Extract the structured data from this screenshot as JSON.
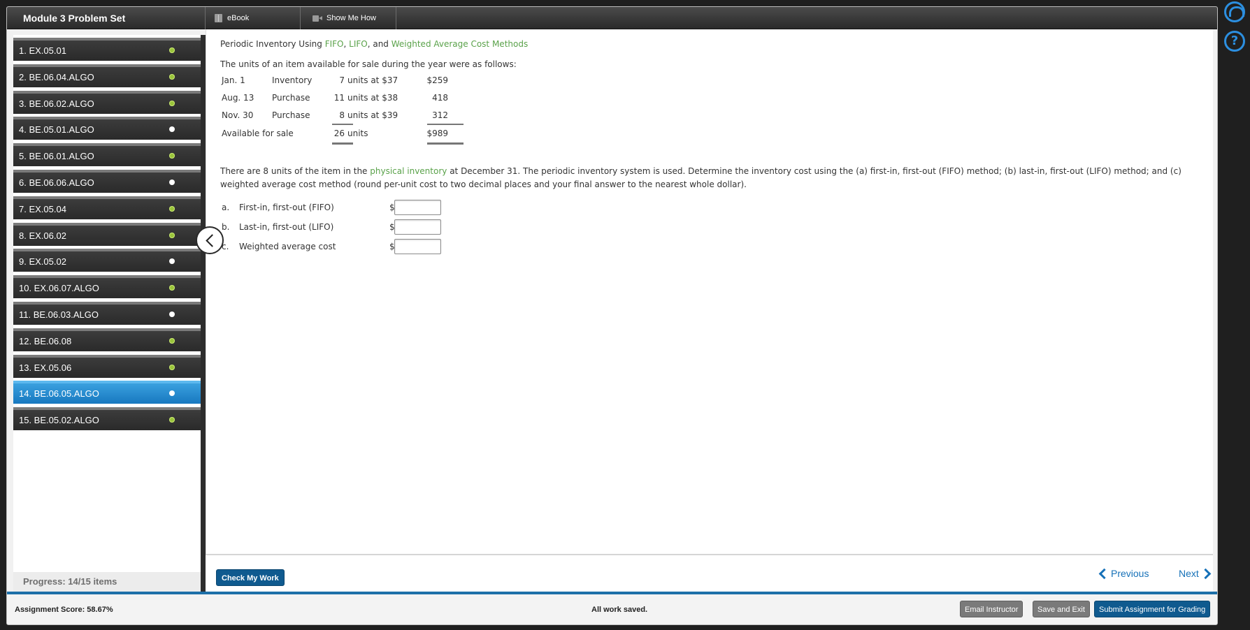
{
  "header": {
    "module_title": "Module 3 Problem Set",
    "tabs": [
      {
        "label": "eBook",
        "icon": "book-icon"
      },
      {
        "label": "Show Me How",
        "icon": "video-icon"
      }
    ]
  },
  "sidebar": {
    "items": [
      {
        "label": "1. EX.05.01",
        "status": "done"
      },
      {
        "label": "2. BE.06.04.ALGO",
        "status": "done"
      },
      {
        "label": "3. BE.06.02.ALGO",
        "status": "done"
      },
      {
        "label": "4. BE.05.01.ALGO",
        "status": "open"
      },
      {
        "label": "5. BE.06.01.ALGO",
        "status": "done"
      },
      {
        "label": "6. BE.06.06.ALGO",
        "status": "open"
      },
      {
        "label": "7. EX.05.04",
        "status": "done"
      },
      {
        "label": "8. EX.06.02",
        "status": "done"
      },
      {
        "label": "9. EX.05.02",
        "status": "open"
      },
      {
        "label": "10. EX.06.07.ALGO",
        "status": "done"
      },
      {
        "label": "11. BE.06.03.ALGO",
        "status": "open"
      },
      {
        "label": "12. BE.06.08",
        "status": "done"
      },
      {
        "label": "13. EX.05.06",
        "status": "done"
      },
      {
        "label": "14. BE.06.05.ALGO",
        "status": "open",
        "active": true
      },
      {
        "label": "15. BE.05.02.ALGO",
        "status": "done"
      }
    ],
    "progress": "Progress:  14/15 items"
  },
  "problem": {
    "heading_prefix": "Periodic Inventory Using ",
    "heading_link1": "FIFO",
    "heading_sep1": ", ",
    "heading_link2": "LIFO",
    "heading_sep2": ", and ",
    "heading_link3": "Weighted Average Cost Methods",
    "intro": "The units of an item available for sale during the year were as follows:",
    "rows": [
      {
        "date": "Jan. 1",
        "desc": "Inventory",
        "qty": "7",
        "unit": "units at $37",
        "amount": "$259"
      },
      {
        "date": "Aug. 13",
        "desc": "Purchase",
        "qty": "11",
        "unit": "units at $38",
        "amount": "418"
      },
      {
        "date": "Nov. 30",
        "desc": "Purchase",
        "qty": "8",
        "unit": "units at $39",
        "amount": "312"
      }
    ],
    "total": {
      "label": "Available for sale",
      "qty": "26",
      "unit": "units",
      "amount": "$989"
    },
    "para_pre": "There are 8 units of the item in the ",
    "para_link": "physical inventory",
    "para_post": " at December 31. The periodic inventory system is used. Determine the inventory cost using the (a) first-in, first-out (FIFO) method; (b) last-in, first-out (LIFO) method; and (c) weighted average cost method (round per-unit cost to two decimal places and your final answer to the nearest whole dollar).",
    "answers": [
      {
        "letter": "a.",
        "label": "First-in, first-out (FIFO)",
        "currency": "$",
        "value": ""
      },
      {
        "letter": "b.",
        "label": "Last-in, first-out (LIFO)",
        "currency": "$",
        "value": ""
      },
      {
        "letter": "c.",
        "label": "Weighted average cost",
        "currency": "$",
        "value": ""
      }
    ]
  },
  "footer": {
    "check_label": "Check My Work",
    "previous_label": "Previous",
    "next_label": "Next"
  },
  "status": {
    "score": "Assignment Score: 58.67%",
    "saved": "All work saved.",
    "email_label": "Email Instructor",
    "save_exit_label": "Save and Exit",
    "submit_label": "Submit Assignment for Grading"
  },
  "colors": {
    "accent_blue": "#1671b8",
    "link_green": "#5aa24a",
    "done_green": "#9ac43b"
  }
}
